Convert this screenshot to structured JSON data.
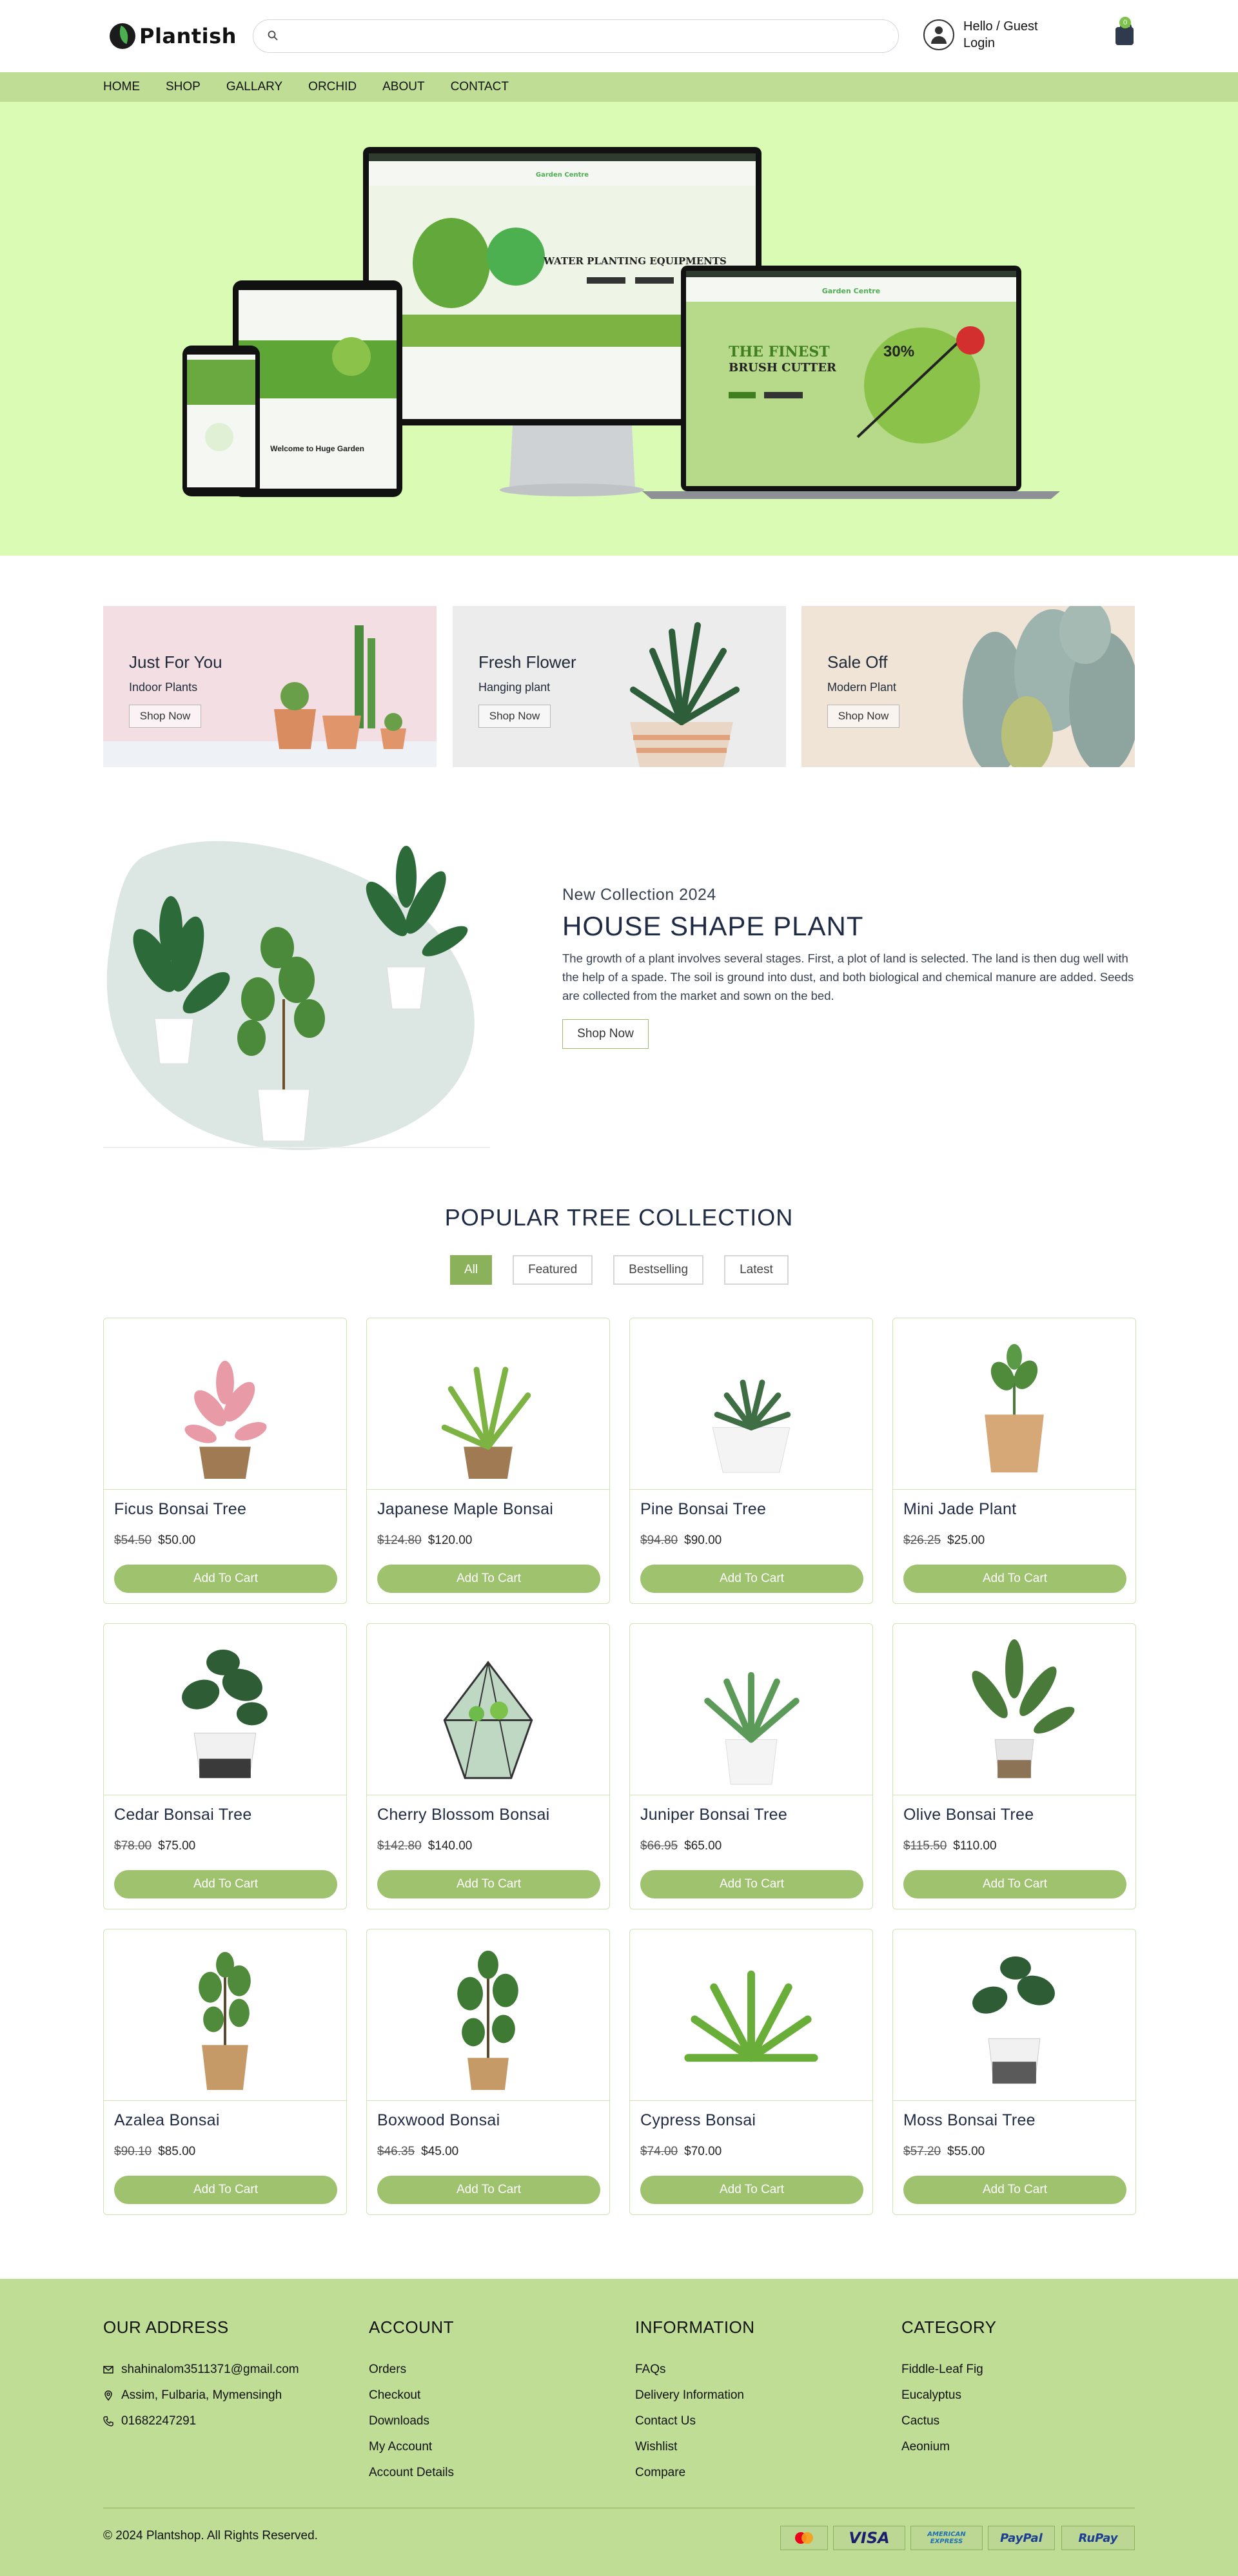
{
  "header": {
    "logo_text": "Plantish",
    "search_placeholder": "",
    "account_greeting": "Hello / Guest",
    "account_action": "Login",
    "cart_count": "0"
  },
  "nav": [
    "HOME",
    "SHOP",
    "GALLARY",
    "ORCHID",
    "ABOUT",
    "CONTACT"
  ],
  "banners": [
    {
      "title": "Just For You",
      "subtitle": "Indoor Plants",
      "button": "Shop Now"
    },
    {
      "title": "Fresh Flower",
      "subtitle": "Hanging plant",
      "button": "Shop Now"
    },
    {
      "title": "Sale Off",
      "subtitle": "Modern Plant",
      "button": "Shop Now"
    }
  ],
  "collection": {
    "eyebrow": "New Collection 2024",
    "title": "HOUSE SHAPE PLANT",
    "description": "The growth of a plant involves several stages. First, a plot of land is selected. The land is then dug well with the help of a spade. The soil is ground into dust, and both biological and chemical manure are added. Seeds are collected from the market and sown on the bed.",
    "button": "Shop Now"
  },
  "popular": {
    "title": "POPULAR TREE COLLECTION",
    "filters": [
      "All",
      "Featured",
      "Bestselling",
      "Latest"
    ],
    "active_filter": "All",
    "add_label": "Add To Cart",
    "products": [
      {
        "name": "Ficus Bonsai Tree",
        "old_price": "$54.50",
        "price": "$50.00"
      },
      {
        "name": "Japanese Maple Bonsai",
        "old_price": "$124.80",
        "price": "$120.00"
      },
      {
        "name": "Pine Bonsai Tree",
        "old_price": "$94.80",
        "price": "$90.00"
      },
      {
        "name": "Mini Jade Plant",
        "old_price": "$26.25",
        "price": "$25.00"
      },
      {
        "name": "Cedar Bonsai Tree",
        "old_price": "$78.00",
        "price": "$75.00"
      },
      {
        "name": "Cherry Blossom Bonsai",
        "old_price": "$142.80",
        "price": "$140.00"
      },
      {
        "name": "Juniper Bonsai Tree",
        "old_price": "$66.95",
        "price": "$65.00"
      },
      {
        "name": "Olive Bonsai Tree",
        "old_price": "$115.50",
        "price": "$110.00"
      },
      {
        "name": "Azalea Bonsai",
        "old_price": "$90.10",
        "price": "$85.00"
      },
      {
        "name": "Boxwood Bonsai",
        "old_price": "$46.35",
        "price": "$45.00"
      },
      {
        "name": "Cypress Bonsai",
        "old_price": "$74.00",
        "price": "$70.00"
      },
      {
        "name": "Moss Bonsai Tree",
        "old_price": "$57.20",
        "price": "$55.00"
      }
    ]
  },
  "footer": {
    "address_title": "OUR ADDRESS",
    "email": "shahinalom3511371@gmail.com",
    "location": "Assim, Fulbaria, Mymensingh",
    "phone": "01682247291",
    "account_title": "ACCOUNT",
    "account_links": [
      "Orders",
      "Checkout",
      "Downloads",
      "My Account",
      "Account Details"
    ],
    "info_title": "INFORMATION",
    "info_links": [
      "FAQs",
      "Delivery Information",
      "Contact Us",
      "Wishlist",
      "Compare"
    ],
    "category_title": "CATEGORY",
    "category_links": [
      "Fiddle-Leaf Fig",
      "Eucalyptus",
      "Cactus",
      "Aeonium"
    ],
    "copyright": "© 2024 Plantshop. All Rights Reserved.",
    "payments": [
      "VISA",
      "AMERICAN EXPRESS",
      "PayPal",
      "RuPay"
    ]
  },
  "hero_mockup": {
    "monitor_heading": "WATER PLANTING EQUIPMENTS",
    "laptop_heading_1": "THE FINEST",
    "laptop_heading_2": "BRUSH CUTTER",
    "laptop_discount": "30%",
    "brand": "Garden Centre",
    "tablet_heading": "Welcome to Huge Garden"
  },
  "colors": {
    "nav_bg": "#c0dd95",
    "hero_bg": "#d9fbb3",
    "accent": "#8bb25a",
    "button": "#9fc26e",
    "footer_bg": "#c0dd95"
  }
}
